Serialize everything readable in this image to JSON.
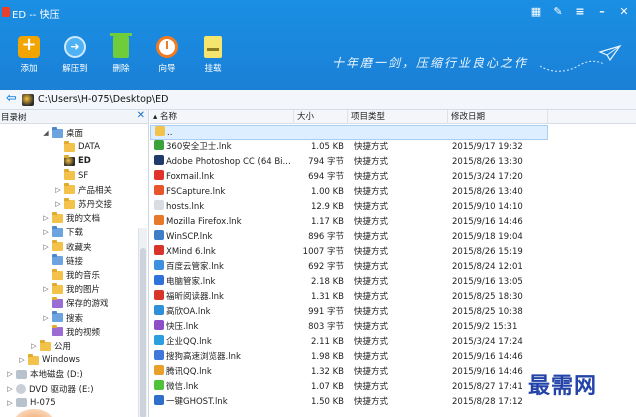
{
  "window": {
    "title": "ED -- 快压"
  },
  "toolbar": [
    {
      "label": "添加",
      "icon": "add-icon"
    },
    {
      "label": "解压到",
      "icon": "extract-icon"
    },
    {
      "label": "删除",
      "icon": "delete-icon"
    },
    {
      "label": "向导",
      "icon": "wizard-icon"
    },
    {
      "label": "挂载",
      "icon": "mount-icon"
    }
  ],
  "slogan": "十年磨一剑，压缩行业良心之作",
  "address": {
    "path": "C:\\Users\\H-075\\Desktop\\ED"
  },
  "tree": {
    "title": "目录树",
    "items": [
      {
        "label": "桌面",
        "indent": 3,
        "caret": "◢",
        "kind": "blue"
      },
      {
        "label": "DATA",
        "indent": 4,
        "caret": "",
        "kind": ""
      },
      {
        "label": "ED",
        "indent": 4,
        "caret": "",
        "kind": "app",
        "selected": true
      },
      {
        "label": "SF",
        "indent": 4,
        "caret": "",
        "kind": ""
      },
      {
        "label": "产品相关",
        "indent": 4,
        "caret": "▷",
        "kind": ""
      },
      {
        "label": "苏丹交接",
        "indent": 4,
        "caret": "▷",
        "kind": ""
      },
      {
        "label": "我的文档",
        "indent": 3,
        "caret": "▷",
        "kind": ""
      },
      {
        "label": "下载",
        "indent": 3,
        "caret": "▷",
        "kind": "blue"
      },
      {
        "label": "收藏夹",
        "indent": 3,
        "caret": "▷",
        "kind": ""
      },
      {
        "label": "链接",
        "indent": 3,
        "caret": "",
        "kind": "blue"
      },
      {
        "label": "我的音乐",
        "indent": 3,
        "caret": "",
        "kind": ""
      },
      {
        "label": "我的图片",
        "indent": 3,
        "caret": "▷",
        "kind": ""
      },
      {
        "label": "保存的游戏",
        "indent": 3,
        "caret": "",
        "kind": "purple"
      },
      {
        "label": "搜索",
        "indent": 3,
        "caret": "▷",
        "kind": "blue"
      },
      {
        "label": "我的视频",
        "indent": 3,
        "caret": "",
        "kind": "purple"
      },
      {
        "label": "公用",
        "indent": 2,
        "caret": "▷",
        "kind": ""
      },
      {
        "label": "Windows",
        "indent": 1,
        "caret": "▷",
        "kind": ""
      },
      {
        "label": "本地磁盘 (D:)",
        "indent": 0,
        "caret": "▷",
        "kind": "drive"
      },
      {
        "label": "DVD 驱动器 (E:)",
        "indent": 0,
        "caret": "▷",
        "kind": "cdrom"
      },
      {
        "label": "H-075",
        "indent": 0,
        "caret": "▷",
        "kind": "drive"
      }
    ]
  },
  "columns": {
    "name": "名称",
    "size": "大小",
    "type": "项目类型",
    "date": "修改日期"
  },
  "files": [
    {
      "name": "..",
      "size": "",
      "type": "",
      "date": "",
      "color": "#f2c24a"
    },
    {
      "name": "360安全卫士.lnk",
      "size": "1.05 KB",
      "type": "快捷方式",
      "date": "2015/9/17 19:32",
      "color": "#3aa23a"
    },
    {
      "name": "Adobe Photoshop CC (64 Bi...",
      "size": "794 字节",
      "type": "快捷方式",
      "date": "2015/8/26 13:30",
      "color": "#1f3b6b"
    },
    {
      "name": "Foxmail.lnk",
      "size": "694 字节",
      "type": "快捷方式",
      "date": "2015/3/24 17:20",
      "color": "#e0322a"
    },
    {
      "name": "FSCapture.lnk",
      "size": "1.00 KB",
      "type": "快捷方式",
      "date": "2015/8/26 13:40",
      "color": "#e8552a"
    },
    {
      "name": "hosts.lnk",
      "size": "12.9 KB",
      "type": "快捷方式",
      "date": "2015/9/10 14:10",
      "color": "#d9dde2"
    },
    {
      "name": "Mozilla Firefox.lnk",
      "size": "1.17 KB",
      "type": "快捷方式",
      "date": "2015/9/16 14:46",
      "color": "#e8782a"
    },
    {
      "name": "WinSCP.lnk",
      "size": "896 字节",
      "type": "快捷方式",
      "date": "2015/9/18 19:04",
      "color": "#3e7ec8"
    },
    {
      "name": "XMind 6.lnk",
      "size": "1007 字节",
      "type": "快捷方式",
      "date": "2015/8/26 15:19",
      "color": "#d8342a"
    },
    {
      "name": "百度云管家.lnk",
      "size": "692 字节",
      "type": "快捷方式",
      "date": "2015/8/24 12:01",
      "color": "#3f8fe0"
    },
    {
      "name": "电脑管家.lnk",
      "size": "2.18 KB",
      "type": "快捷方式",
      "date": "2015/9/16 13:05",
      "color": "#2f72d8"
    },
    {
      "name": "福昕阅读器.lnk",
      "size": "1.31 KB",
      "type": "快捷方式",
      "date": "2015/8/25 18:30",
      "color": "#d8342a"
    },
    {
      "name": "高欣OA.lnk",
      "size": "991 字节",
      "type": "快捷方式",
      "date": "2015/8/25 10:38",
      "color": "#2f8fd8"
    },
    {
      "name": "快压.lnk",
      "size": "803 字节",
      "type": "快捷方式",
      "date": "2015/9/2 15:31",
      "color": "#8c4fc8"
    },
    {
      "name": "企业QQ.lnk",
      "size": "2.11 KB",
      "type": "快捷方式",
      "date": "2015/3/24 17:24",
      "color": "#2b9ee0"
    },
    {
      "name": "搜狗高速浏览器.lnk",
      "size": "1.98 KB",
      "type": "快捷方式",
      "date": "2015/9/16 14:46",
      "color": "#3f78d8"
    },
    {
      "name": "腾讯QQ.lnk",
      "size": "1.32 KB",
      "type": "快捷方式",
      "date": "2015/9/16 14:46",
      "color": "#e8a02a"
    },
    {
      "name": "微信.lnk",
      "size": "1.07 KB",
      "type": "快捷方式",
      "date": "2015/8/27 17:41",
      "color": "#4fc23a"
    },
    {
      "name": "一键GHOST.lnk",
      "size": "1.50 KB",
      "type": "快捷方式",
      "date": "2015/8/28 17:12",
      "color": "#2f6fc8"
    }
  ],
  "watermark": "最需网"
}
